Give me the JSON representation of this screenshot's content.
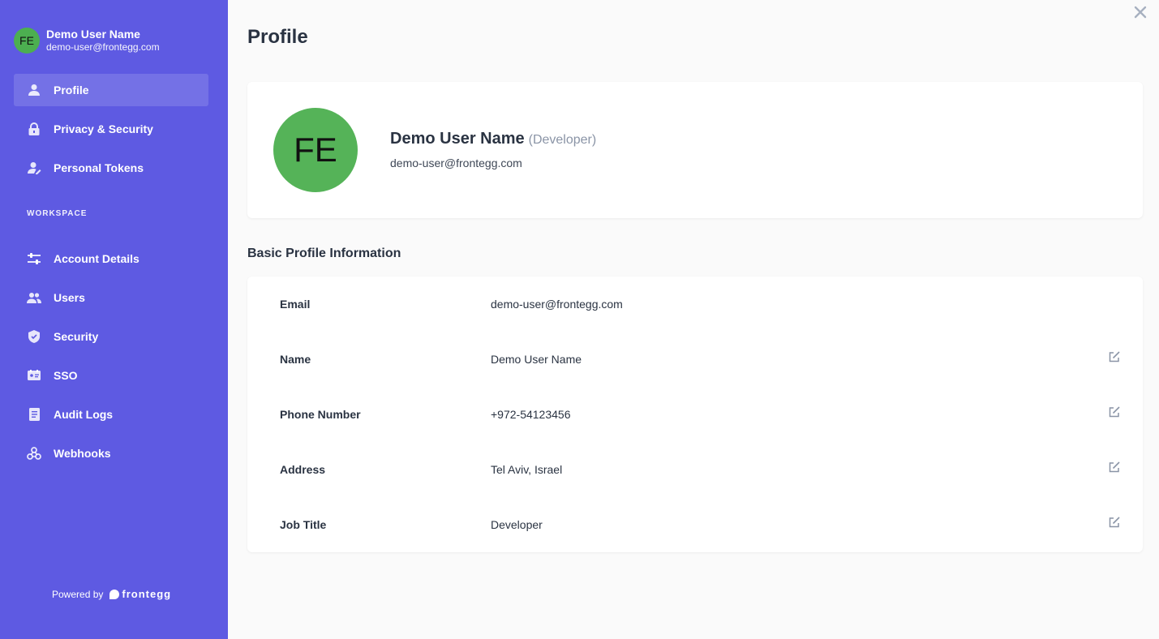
{
  "sidebar": {
    "user": {
      "initials": "FE",
      "name": "Demo User Name",
      "email": "demo-user@frontegg.com"
    },
    "personal_items": [
      {
        "label": "Profile",
        "icon": "user-icon",
        "active": true
      },
      {
        "label": "Privacy & Security",
        "icon": "lock-icon",
        "active": false
      },
      {
        "label": "Personal Tokens",
        "icon": "user-key-icon",
        "active": false
      }
    ],
    "workspace_label": "WORKSPACE",
    "workspace_items": [
      {
        "label": "Account Details",
        "icon": "sliders-icon"
      },
      {
        "label": "Users",
        "icon": "users-icon"
      },
      {
        "label": "Security",
        "icon": "shield-icon"
      },
      {
        "label": "SSO",
        "icon": "id-card-icon"
      },
      {
        "label": "Audit Logs",
        "icon": "document-icon"
      },
      {
        "label": "Webhooks",
        "icon": "webhook-icon"
      }
    ],
    "powered_by": "Powered by",
    "brand": "frontegg"
  },
  "main": {
    "title": "Profile",
    "profile": {
      "initials": "FE",
      "name": "Demo User Name",
      "role": "(Developer)",
      "email": "demo-user@frontegg.com"
    },
    "section_title": "Basic Profile Information",
    "fields": [
      {
        "label": "Email",
        "value": "demo-user@frontegg.com",
        "editable": false
      },
      {
        "label": "Name",
        "value": "Demo User Name",
        "editable": true
      },
      {
        "label": "Phone Number",
        "value": "+972-54123456",
        "editable": true
      },
      {
        "label": "Address",
        "value": "Tel Aviv, Israel",
        "editable": true
      },
      {
        "label": "Job Title",
        "value": "Developer",
        "editable": true
      }
    ]
  },
  "colors": {
    "sidebar_bg": "#5e5ae2",
    "avatar_bg": "#55b358",
    "page_bg": "#fafafa"
  }
}
